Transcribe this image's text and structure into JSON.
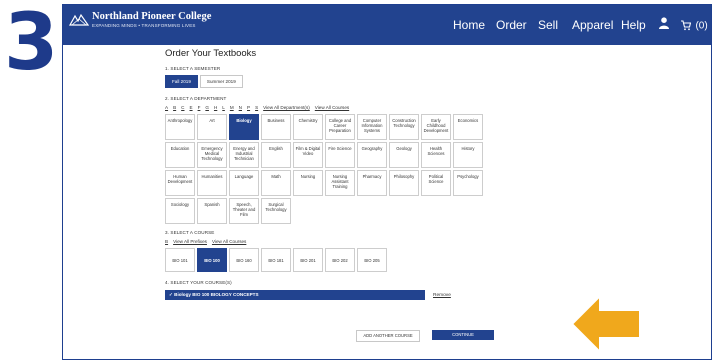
{
  "step_number": "3",
  "nav": {
    "logo_title": "Northland Pioneer College",
    "logo_tagline": "Expanding Minds • Transforming Lives",
    "items": [
      "Home",
      "Order",
      "Sell",
      "Apparel",
      "Help"
    ],
    "user_icon": "user-icon",
    "cart_icon": "cart-icon",
    "cart_count": "(0)"
  },
  "colors": {
    "brand": "#22438f",
    "accent_arrow": "#f0a81c"
  },
  "page_title": "Order Your Textbooks",
  "semester": {
    "label": "1. SELECT A SEMESTER",
    "options": [
      "Fall 2019",
      "Summer 2019"
    ],
    "selected": "Fall 2019"
  },
  "department": {
    "label": "2. SELECT A DEPARTMENT",
    "letters": [
      "A",
      "B",
      "C",
      "E",
      "F",
      "G",
      "H",
      "L",
      "M",
      "N",
      "P",
      "S"
    ],
    "view_all_departments": "View All Department(s)",
    "view_all_courses": "View All Courses",
    "items": [
      "Anthropology",
      "Art",
      "Biology",
      "Business",
      "Chemistry",
      "College and Career Preparation",
      "Computer Information Systems",
      "Construction Technology",
      "Early Childhood Development",
      "Economics",
      "Education",
      "Emergency Medical Technology",
      "Energy and Industrial Technician",
      "English",
      "Film & Digital Video",
      "Fire Science",
      "Geography",
      "Geology",
      "Health Sciences",
      "History",
      "Human Development",
      "Humanities",
      "Language",
      "Math",
      "Nursing",
      "Nursing Assistant Training",
      "Pharmacy",
      "Philosophy",
      "Political Science",
      "Psychology",
      "Sociology",
      "Spanish",
      "Speech, Theater and Film",
      "Surgical Technology"
    ],
    "selected": "Biology"
  },
  "course": {
    "label": "3. SELECT A COURSE",
    "letter": "B",
    "view_all_prefixes": "View All Prefixes",
    "view_all_courses": "View All Courses",
    "items": [
      "BIO 101",
      "BIO 100",
      "BIO 160",
      "BIO 181",
      "BIO 201",
      "BIO 202",
      "BIO 205"
    ],
    "selected": "BIO 100"
  },
  "selected_courses": {
    "label": "4. SELECT YOUR COURSE(S)",
    "item": "✓ Biology BIO 100 BIOLOGY CONCEPTS",
    "remove": "Remove"
  },
  "buttons": {
    "add_another": "ADD ANOTHER COURSE",
    "continue": "CONTINUE"
  }
}
